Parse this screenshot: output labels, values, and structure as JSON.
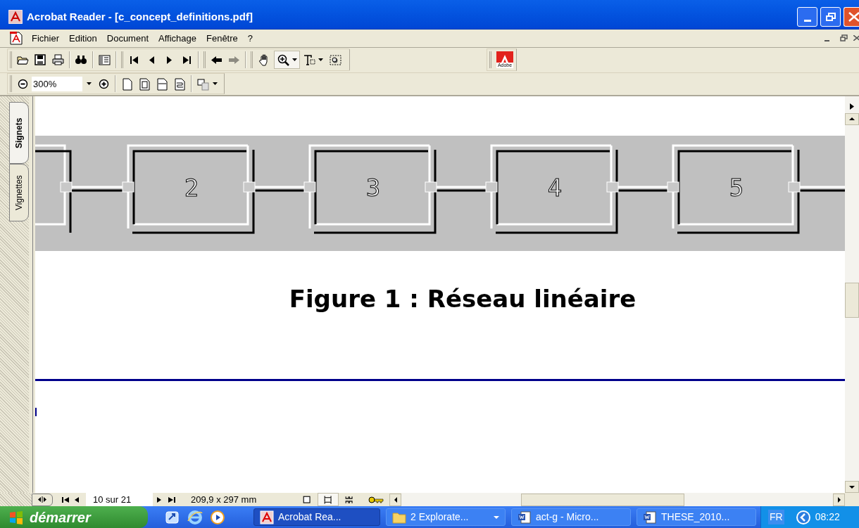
{
  "window": {
    "title": "Acrobat Reader - [c_concept_definitions.pdf]"
  },
  "menu": [
    "Fichier",
    "Edition",
    "Document",
    "Affichage",
    "Fenêtre",
    "?"
  ],
  "history_buttons": [
    {
      "kind": "back",
      "disabled": false
    },
    {
      "kind": "forward",
      "disabled": true
    }
  ],
  "tools": [
    {
      "kind": "hand",
      "selected": false
    },
    {
      "kind": "zoom",
      "selected": true
    },
    {
      "kind": "text",
      "selected": false
    },
    {
      "kind": "snapshot",
      "selected": false
    }
  ],
  "toolbar_logo": "Adobe",
  "zoom_field": {
    "value": "300%"
  },
  "side_tabs": [
    {
      "label": "Signets",
      "selected": true
    },
    {
      "label": "Vignettes",
      "selected": false
    }
  ],
  "document": {
    "figure_nodes": [
      "2",
      "3",
      "4",
      "5"
    ],
    "caption": "Figure 1 : Réseau linéaire"
  },
  "status_bar": {
    "page": "10 sur 21",
    "page_size": "209,9 x 297 mm",
    "view_modes": [
      {
        "kind": "single",
        "selected": false
      },
      {
        "kind": "continuous",
        "selected": true
      },
      {
        "kind": "facing",
        "selected": false
      }
    ]
  },
  "taskbar": {
    "start": "démarrer",
    "tasks": [
      {
        "label": "Acrobat Rea...",
        "kind": "acrobat",
        "selected": true
      },
      {
        "label": "2 Explorate...",
        "kind": "folder",
        "selected": false
      },
      {
        "label": "act-g - Micro...",
        "kind": "word",
        "selected": false
      },
      {
        "label": "THESE_2010...",
        "kind": "word",
        "selected": false
      }
    ],
    "language": "FR",
    "clock": "08:22"
  }
}
